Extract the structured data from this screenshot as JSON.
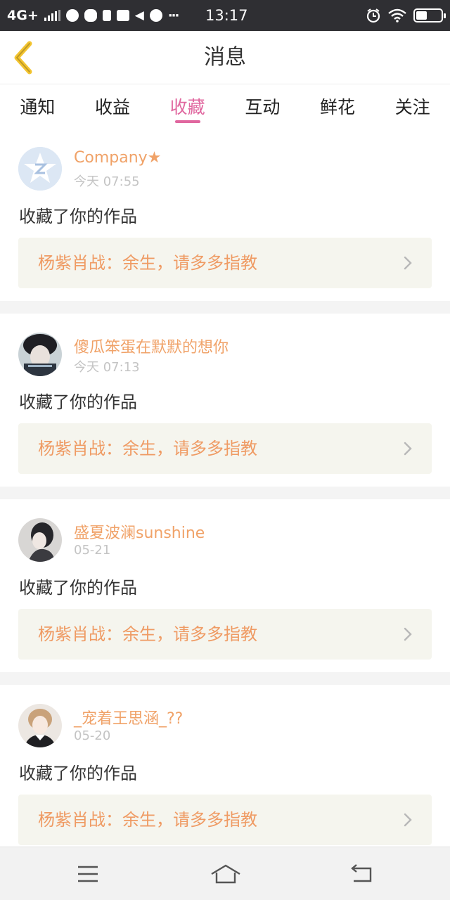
{
  "status_bar": {
    "network": "4G+",
    "time": "13:17",
    "battery_level": 0.45,
    "icons": [
      "signal-icon",
      "browser-icon",
      "cat-icon",
      "android-icon",
      "mail-icon",
      "mute-icon",
      "chat-icon",
      "more-icon",
      "alarm-icon",
      "wifi-icon",
      "battery-icon"
    ],
    "more_glyph": "···"
  },
  "header": {
    "title": "消息",
    "back_icon": "chevron-left-icon",
    "back_color": "#f3c430"
  },
  "tabs": [
    {
      "label": "通知",
      "active": false
    },
    {
      "label": "收益",
      "active": false
    },
    {
      "label": "收藏",
      "active": true
    },
    {
      "label": "互动",
      "active": false
    },
    {
      "label": "鲜花",
      "active": false
    },
    {
      "label": "关注",
      "active": false
    }
  ],
  "colors": {
    "accent_pink": "#e0679f",
    "username_orange": "#f0a268",
    "work_title_orange": "#ef9b64",
    "work_card_bg": "#f5f5ee"
  },
  "messages": [
    {
      "username": "Company★",
      "date": "今天 07:55",
      "action": "收藏了你的作品",
      "work_title": "杨紫肖战：余生，请多多指教",
      "avatar": "qq-default-avatar-icon"
    },
    {
      "username": "傻瓜笨蛋在默默的想你",
      "date": "今天 07:13",
      "action": "收藏了你的作品",
      "work_title": "杨紫肖战：余生，请多多指教",
      "avatar": "user-photo-avatar"
    },
    {
      "username": "盛夏波澜sunshine",
      "date": "05-21",
      "action": "收藏了你的作品",
      "work_title": "杨紫肖战：余生，请多多指教",
      "avatar": "user-photo-avatar"
    },
    {
      "username": "_宠着王思涵_??",
      "date": "05-20",
      "action": "收藏了你的作品",
      "work_title": "杨紫肖战：余生，请多多指教",
      "avatar": "user-photo-avatar"
    }
  ],
  "nav_bar": {
    "buttons": [
      "menu-icon",
      "home-icon",
      "back-icon"
    ]
  }
}
